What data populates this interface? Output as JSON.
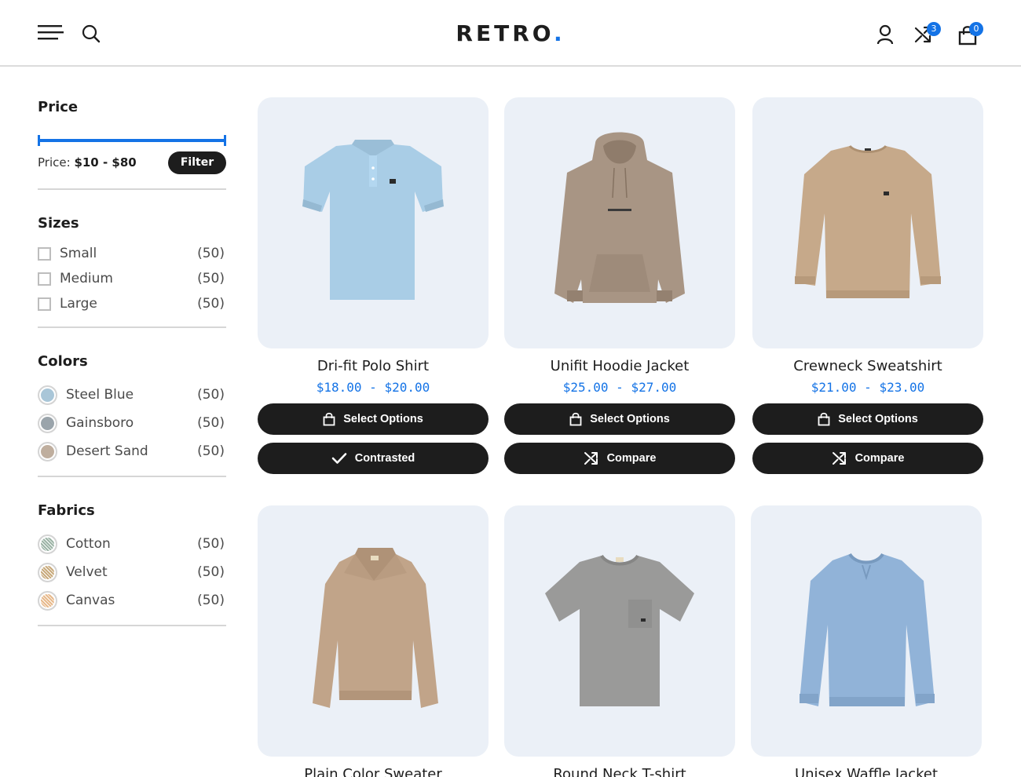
{
  "header": {
    "logo_text": "RETRO",
    "logo_dot": ".",
    "compare_count": "3",
    "cart_count": "0"
  },
  "sidebar": {
    "price": {
      "title": "Price",
      "label": "Price:",
      "range": "$10 - $80",
      "filter_label": "Filter",
      "range_min_fraction": 0.0,
      "range_max_fraction": 1.0
    },
    "sizes": {
      "title": "Sizes",
      "items": [
        {
          "label": "Small",
          "count": "(50)"
        },
        {
          "label": "Medium",
          "count": "(50)"
        },
        {
          "label": "Large",
          "count": "(50)"
        }
      ]
    },
    "colors": {
      "title": "Colors",
      "items": [
        {
          "label": "Steel Blue",
          "count": "(50)",
          "color": "#a9c6d8"
        },
        {
          "label": "Gainsboro",
          "count": "(50)",
          "color": "#9aa4ab"
        },
        {
          "label": "Desert Sand",
          "count": "(50)",
          "color": "#bfae9e"
        }
      ]
    },
    "fabrics": {
      "title": "Fabrics",
      "items": [
        {
          "label": "Cotton",
          "count": "(50)",
          "color": "#9cb4a6"
        },
        {
          "label": "Velvet",
          "count": "(50)",
          "color": "#c8aa7c"
        },
        {
          "label": "Canvas",
          "count": "(50)",
          "color": "#e7b98b"
        }
      ]
    }
  },
  "products": [
    {
      "name": "Dri-fit Polo Shirt",
      "price": "$18.00 - $20.00",
      "select_label": "Select Options",
      "compare_label": "Contrasted",
      "compare_icon": "check-icon",
      "garment": "polo",
      "color": "#a9cde6"
    },
    {
      "name": "Unifit Hoodie Jacket",
      "price": "$25.00 - $27.00",
      "select_label": "Select Options",
      "compare_label": "Compare",
      "compare_icon": "shuffle-icon",
      "garment": "hoodie",
      "color": "#a89584"
    },
    {
      "name": "Crewneck Sweatshirt",
      "price": "$21.00 - $23.00",
      "select_label": "Select Options",
      "compare_label": "Compare",
      "compare_icon": "shuffle-icon",
      "garment": "sweatshirt",
      "color": "#c6a98a"
    },
    {
      "name": "Plain Color Sweater",
      "garment": "sweater",
      "color": "#c1a489"
    },
    {
      "name": "Round Neck T-shirt",
      "garment": "tshirt",
      "color": "#9a9a99"
    },
    {
      "name": "Unisex Waffle Jacket",
      "garment": "waffle",
      "color": "#91b3d8"
    }
  ],
  "colors": {
    "accent": "#1473e6",
    "button_bg": "#1d1d1d",
    "card_bg": "#ebf0f7"
  }
}
